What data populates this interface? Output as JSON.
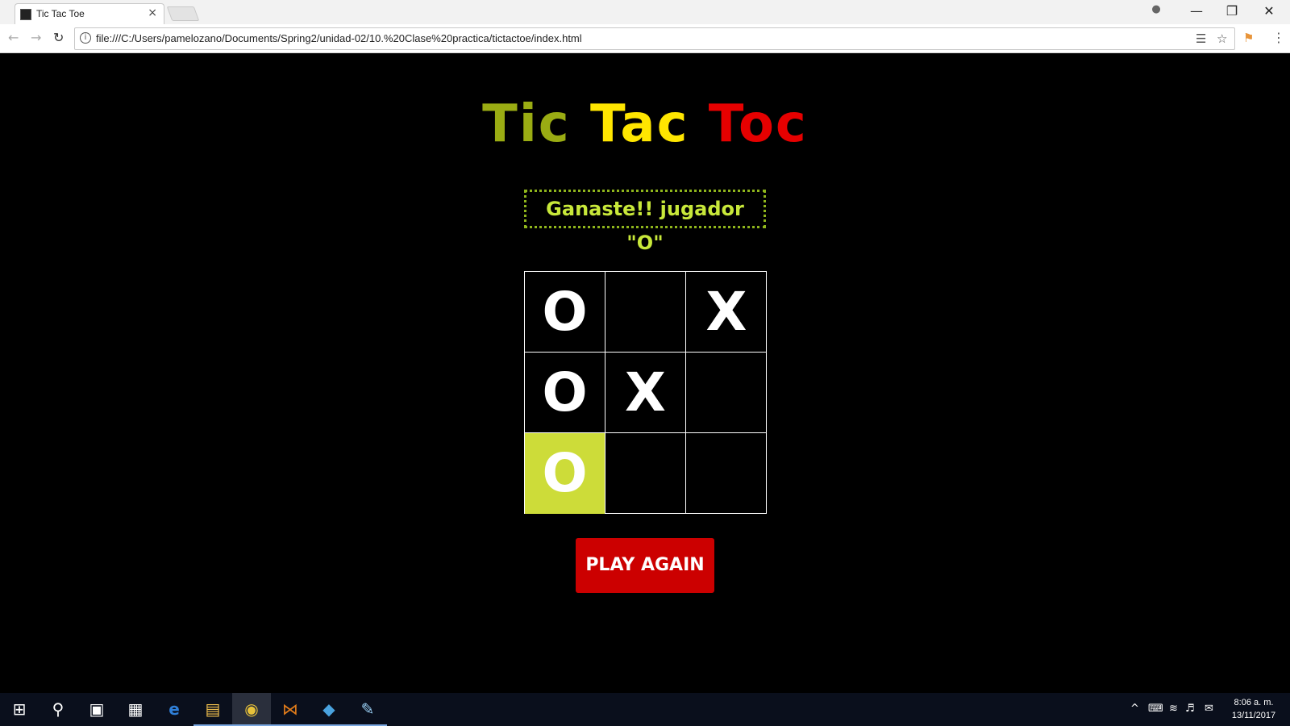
{
  "browser": {
    "tab_title": "Tic Tac Toe",
    "tab_close": "×",
    "url": "file:///C:/Users/pamelozano/Documents/Spring2/unidad-02/10.%20Clase%20practica/tictactoe/index.html",
    "controls": {
      "minimize": "—",
      "restore": "❐",
      "close": "✕",
      "profile": "●"
    }
  },
  "game": {
    "title_parts": [
      "Tic",
      "Tac",
      "Toc"
    ],
    "title_colors": [
      "#9aac13",
      "#ffe600",
      "#e60000"
    ],
    "status": "Ganaste!! jugador \"O\"",
    "board": [
      [
        "O",
        "",
        "X"
      ],
      [
        "O",
        "X",
        ""
      ],
      [
        "O",
        "",
        ""
      ]
    ],
    "winning_cell": [
      2,
      0
    ],
    "play_again_label": "PLAY AGAIN"
  },
  "taskbar": {
    "clock_time": "8:06 a. m.",
    "clock_date": "13/11/2017",
    "icons": [
      "windows-start-icon",
      "search-icon",
      "task-view-icon",
      "store-icon",
      "edge-icon",
      "file-explorer-icon",
      "chrome-icon",
      "visual-studio-icon",
      "git-icon",
      "paint-icon"
    ]
  }
}
